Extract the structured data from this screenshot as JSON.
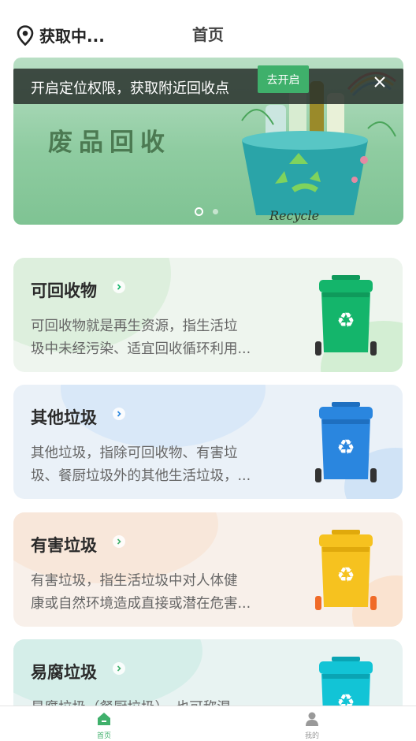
{
  "header": {
    "location_text": "获取中...",
    "title": "首页"
  },
  "banner": {
    "text": "废品回收",
    "art_text": "Recycle",
    "dots_active": 1,
    "dots_total": 2
  },
  "location_prompt": {
    "text": "开启定位权限，获取附近回收点",
    "button_label": "去开启"
  },
  "categories": [
    {
      "title": "可回收物",
      "desc_line1": "可回收物就是再生资源，指生活垃",
      "desc_line2": "圾中未经污染、适宜回收循环利用...",
      "color": "#14b56b"
    },
    {
      "title": "其他垃圾",
      "desc_line1": "其他垃圾，指除可回收物、有害垃",
      "desc_line2": "圾、餐厨垃圾外的其他生活垃圾，...",
      "color": "#2a86df"
    },
    {
      "title": "有害垃圾",
      "desc_line1": "有害垃圾，指生活垃圾中对人体健",
      "desc_line2": "康或自然环境造成直接或潜在危害...",
      "color": "#f6c21f"
    },
    {
      "title": "易腐垃圾",
      "desc_line1": "易腐垃圾（餐厨垃圾），也可称湿",
      "desc_line2": "",
      "color": "#12c4d6"
    }
  ],
  "tabbar": {
    "home_label": "首页",
    "mine_label": "我的",
    "active_color": "#3fb06b",
    "inactive_color": "#999999"
  }
}
